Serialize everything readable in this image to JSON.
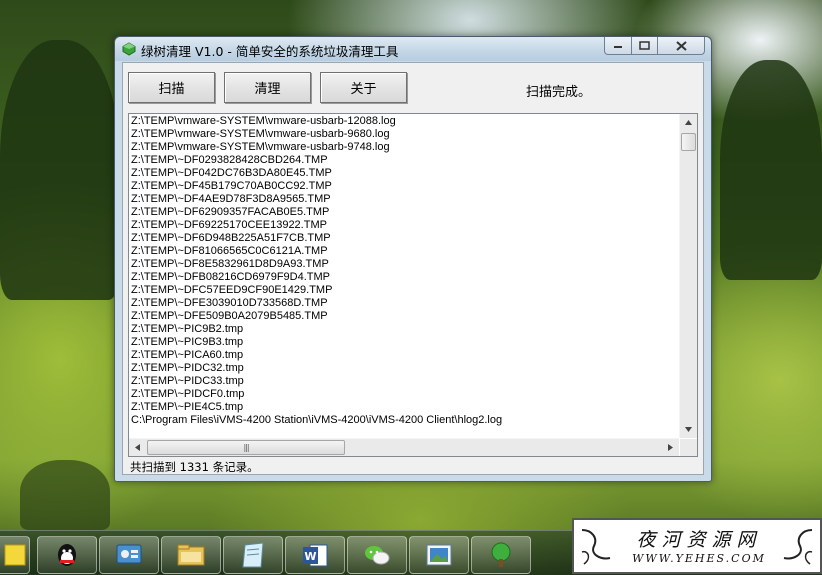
{
  "window": {
    "title": "绿树清理 V1.0 - 简单安全的系统垃圾清理工具"
  },
  "toolbar": {
    "scan_label": "扫描",
    "clean_label": "清理",
    "about_label": "关于",
    "status": "扫描完成。"
  },
  "list": {
    "items": [
      "Z:\\TEMP\\vmware-SYSTEM\\vmware-usbarb-12088.log",
      "Z:\\TEMP\\vmware-SYSTEM\\vmware-usbarb-9680.log",
      "Z:\\TEMP\\vmware-SYSTEM\\vmware-usbarb-9748.log",
      "Z:\\TEMP\\~DF0293828428CBD264.TMP",
      "Z:\\TEMP\\~DF042DC76B3DA80E45.TMP",
      "Z:\\TEMP\\~DF45B179C70AB0CC92.TMP",
      "Z:\\TEMP\\~DF4AE9D78F3D8A9565.TMP",
      "Z:\\TEMP\\~DF62909357FACAB0E5.TMP",
      "Z:\\TEMP\\~DF69225170CEE13922.TMP",
      "Z:\\TEMP\\~DF6D948B225A51F7CB.TMP",
      "Z:\\TEMP\\~DF81066565C0C6121A.TMP",
      "Z:\\TEMP\\~DF8E5832961D8D9A93.TMP",
      "Z:\\TEMP\\~DFB08216CD6979F9D4.TMP",
      "Z:\\TEMP\\~DFC57EED9CF90E1429.TMP",
      "Z:\\TEMP\\~DFE3039010D733568D.TMP",
      "Z:\\TEMP\\~DFE509B0A2079B5485.TMP",
      "Z:\\TEMP\\~PIC9B2.tmp",
      "Z:\\TEMP\\~PIC9B3.tmp",
      "Z:\\TEMP\\~PICA60.tmp",
      "Z:\\TEMP\\~PIDC32.tmp",
      "Z:\\TEMP\\~PIDC33.tmp",
      "Z:\\TEMP\\~PIDCF0.tmp",
      "Z:\\TEMP\\~PIE4C5.tmp",
      "C:\\Program Files\\iVMS-4200 Station\\iVMS-4200\\iVMS-4200 Client\\hlog2.log"
    ]
  },
  "footer": {
    "summary": "共扫描到 1331 条记录。"
  },
  "taskbar": {
    "items": [
      "sticky-notes-icon",
      "qq-icon",
      "control-panel-icon",
      "file-explorer-icon",
      "notepad-icon",
      "word-icon",
      "wechat-icon",
      "photo-viewer-icon",
      "green-tree-icon"
    ]
  },
  "watermark": {
    "title": "夜河资源网",
    "url": "WWW.YEHES.COM"
  },
  "colors": {
    "window_frame": "#c9dbe8",
    "client_bg": "#f0f0f0",
    "list_bg": "#ffffff"
  }
}
